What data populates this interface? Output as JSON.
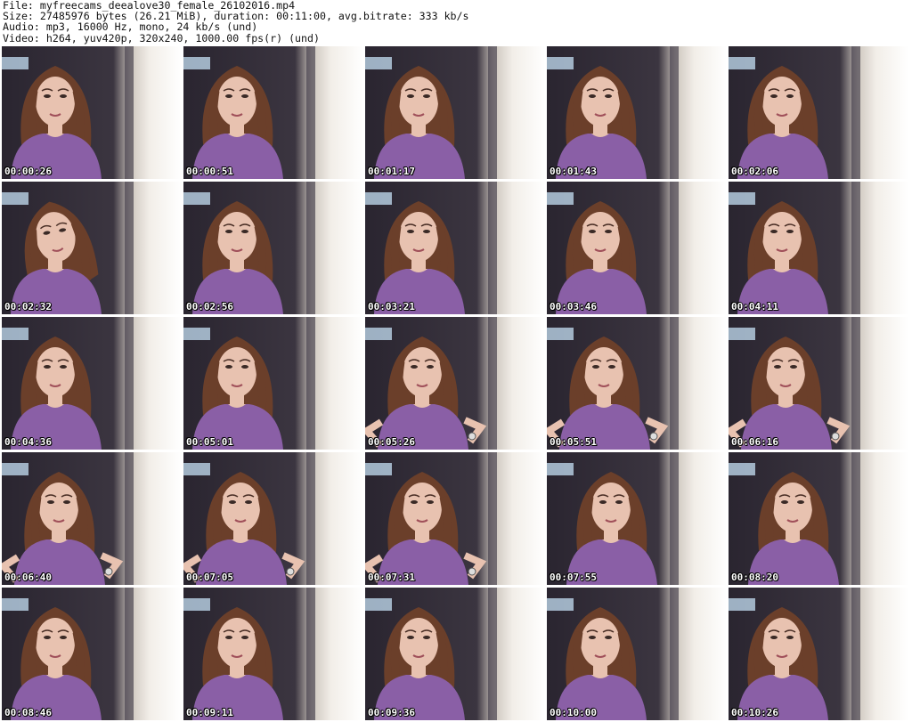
{
  "header": {
    "file_line": "File: myfreecams_deealove30_female_26102016.mp4",
    "size_line": "Size: 27485976 bytes (26.21 MiB), duration: 00:11:00, avg.bitrate: 333 kb/s",
    "audio_line": "Audio: mp3, 16000 Hz, mono, 24 kb/s (und)",
    "video_line": "Video: h264, yuv420p, 320x240, 1000.00 fps(r) (und)"
  },
  "thumbnails": [
    {
      "timestamp": "00:00:26",
      "pose": "talk"
    },
    {
      "timestamp": "00:00:51",
      "pose": "talk"
    },
    {
      "timestamp": "00:01:17",
      "pose": "talk"
    },
    {
      "timestamp": "00:01:43",
      "pose": "talk"
    },
    {
      "timestamp": "00:02:06",
      "pose": "talk"
    },
    {
      "timestamp": "00:02:32",
      "pose": "tilt"
    },
    {
      "timestamp": "00:02:56",
      "pose": "talk"
    },
    {
      "timestamp": "00:03:21",
      "pose": "talk"
    },
    {
      "timestamp": "00:03:46",
      "pose": "talk"
    },
    {
      "timestamp": "00:04:11",
      "pose": "talk"
    },
    {
      "timestamp": "00:04:36",
      "pose": "talk"
    },
    {
      "timestamp": "00:05:01",
      "pose": "talk"
    },
    {
      "timestamp": "00:05:26",
      "pose": "hips"
    },
    {
      "timestamp": "00:05:51",
      "pose": "hips"
    },
    {
      "timestamp": "00:06:16",
      "pose": "hips"
    },
    {
      "timestamp": "00:06:40",
      "pose": "hips"
    },
    {
      "timestamp": "00:07:05",
      "pose": "hips"
    },
    {
      "timestamp": "00:07:31",
      "pose": "hips"
    },
    {
      "timestamp": "00:07:55",
      "pose": "lean"
    },
    {
      "timestamp": "00:08:20",
      "pose": "lean"
    },
    {
      "timestamp": "00:08:46",
      "pose": "talk"
    },
    {
      "timestamp": "00:09:11",
      "pose": "talk"
    },
    {
      "timestamp": "00:09:36",
      "pose": "talk"
    },
    {
      "timestamp": "00:10:00",
      "pose": "talk"
    },
    {
      "timestamp": "00:10:26",
      "pose": "talk"
    }
  ],
  "colors": {
    "shirt": "#8a5fa6",
    "hair": "#6b3f2a",
    "skin": "#e8c2b0",
    "background_dark": "#2a2530",
    "background_light": "#f2eee8",
    "timestamp_text": "#ffffff"
  }
}
